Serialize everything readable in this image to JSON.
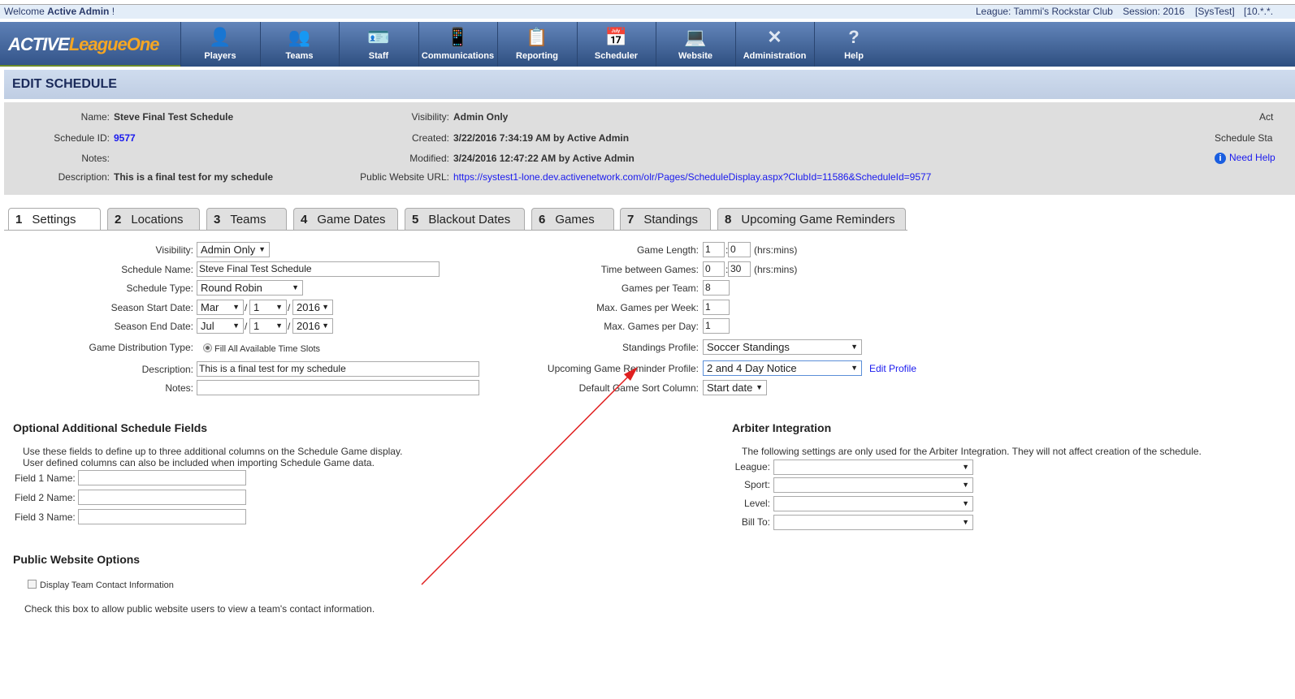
{
  "topbar": {
    "welcome_prefix": "Welcome ",
    "user": "Active Admin",
    "welcome_suffix": " !",
    "league": "League: Tammi's Rockstar Club",
    "session": "Session: 2016",
    "env": "[SysTest]",
    "ip": "[10.*.*."
  },
  "nav": {
    "logo_a": "ACTIVE",
    "logo_b": "LeagueOne",
    "items": [
      {
        "label": "Players",
        "icon": "players-icon"
      },
      {
        "label": "Teams",
        "icon": "teams-icon"
      },
      {
        "label": "Staff",
        "icon": "staff-icon"
      },
      {
        "label": "Communications",
        "icon": "communications-icon"
      },
      {
        "label": "Reporting",
        "icon": "reporting-icon"
      },
      {
        "label": "Scheduler",
        "icon": "calendar-icon"
      },
      {
        "label": "Website",
        "icon": "laptop-icon"
      },
      {
        "label": "Administration",
        "icon": "tools-icon"
      },
      {
        "label": "Help",
        "icon": "help-icon"
      }
    ]
  },
  "page_title": "EDIT SCHEDULE",
  "info": {
    "name_l": "Name:",
    "name": "Steve Final Test Schedule",
    "id_l": "Schedule ID:",
    "id": "9577",
    "notes_l": "Notes:",
    "desc_l": "Description:",
    "desc": "This is a final test for my schedule",
    "vis_l": "Visibility:",
    "vis": "Admin Only",
    "created_l": "Created:",
    "created": "3/22/2016 7:34:19 AM by Active Admin",
    "modified_l": "Modified:",
    "modified": "3/24/2016 12:47:22 AM by Active Admin",
    "url_l": "Public Website URL:",
    "url": "https://systest1-lone.dev.activenetwork.com/olr/Pages/ScheduleDisplay.aspx?ClubId=11586&ScheduleId=9577",
    "act": "Act",
    "status": "Schedule Sta",
    "help": "Need Help"
  },
  "tabs": [
    {
      "n": "1",
      "label": "Settings"
    },
    {
      "n": "2",
      "label": "Locations"
    },
    {
      "n": "3",
      "label": "Teams"
    },
    {
      "n": "4",
      "label": "Game Dates"
    },
    {
      "n": "5",
      "label": "Blackout Dates"
    },
    {
      "n": "6",
      "label": "Games"
    },
    {
      "n": "7",
      "label": "Standings"
    },
    {
      "n": "8",
      "label": "Upcoming Game Reminders"
    }
  ],
  "form": {
    "visibility_l": "Visibility:",
    "visibility": "Admin Only",
    "name_l": "Schedule Name:",
    "name": "Steve Final Test Schedule",
    "type_l": "Schedule Type:",
    "type": "Round Robin",
    "start_l": "Season Start Date:",
    "start_m": "Mar",
    "start_d": "1",
    "start_y": "2016",
    "end_l": "Season End Date:",
    "end_m": "Jul",
    "end_d": "1",
    "end_y": "2016",
    "dist_l": "Game Distribution Type:",
    "dist": "Fill All Available Time Slots",
    "desc_l": "Description:",
    "desc": "This is a final test for my schedule",
    "notes_l": "Notes:",
    "notes": "",
    "len_l": "Game Length:",
    "len_h": "1",
    "len_m": "0",
    "between_l": "Time between Games:",
    "between_h": "0",
    "between_m": "30",
    "hrsmins": "(hrs:mins)",
    "gpt_l": "Games per Team:",
    "gpt": "8",
    "gpw_l": "Max. Games per Week:",
    "gpw": "1",
    "gpd_l": "Max. Games per Day:",
    "gpd": "1",
    "stand_l": "Standings Profile:",
    "stand": "Soccer Standings",
    "rem_l": "Upcoming Game Reminder Profile:",
    "rem": "2 and 4 Day Notice",
    "edit_profile": "Edit Profile",
    "sort_l": "Default Game Sort Column:",
    "sort": "Start date"
  },
  "optional": {
    "title": "Optional Additional Schedule Fields",
    "desc1": "Use these fields to define up to three additional columns on the Schedule Game display.",
    "desc2": "User defined columns can also be included when importing Schedule Game data.",
    "f1": "Field 1 Name:",
    "f2": "Field 2 Name:",
    "f3": "Field 3 Name:"
  },
  "public": {
    "title": "Public Website Options",
    "checkbox": "Display Team Contact Information",
    "desc": "Check this box to allow public website users to view a team's contact information."
  },
  "arbiter": {
    "title": "Arbiter Integration",
    "desc": "The following settings are only used for the Arbiter Integration. They will not affect creation of the schedule.",
    "league": "League:",
    "sport": "Sport:",
    "level": "Level:",
    "bill": "Bill To:"
  },
  "annotation_color": "#e02020"
}
